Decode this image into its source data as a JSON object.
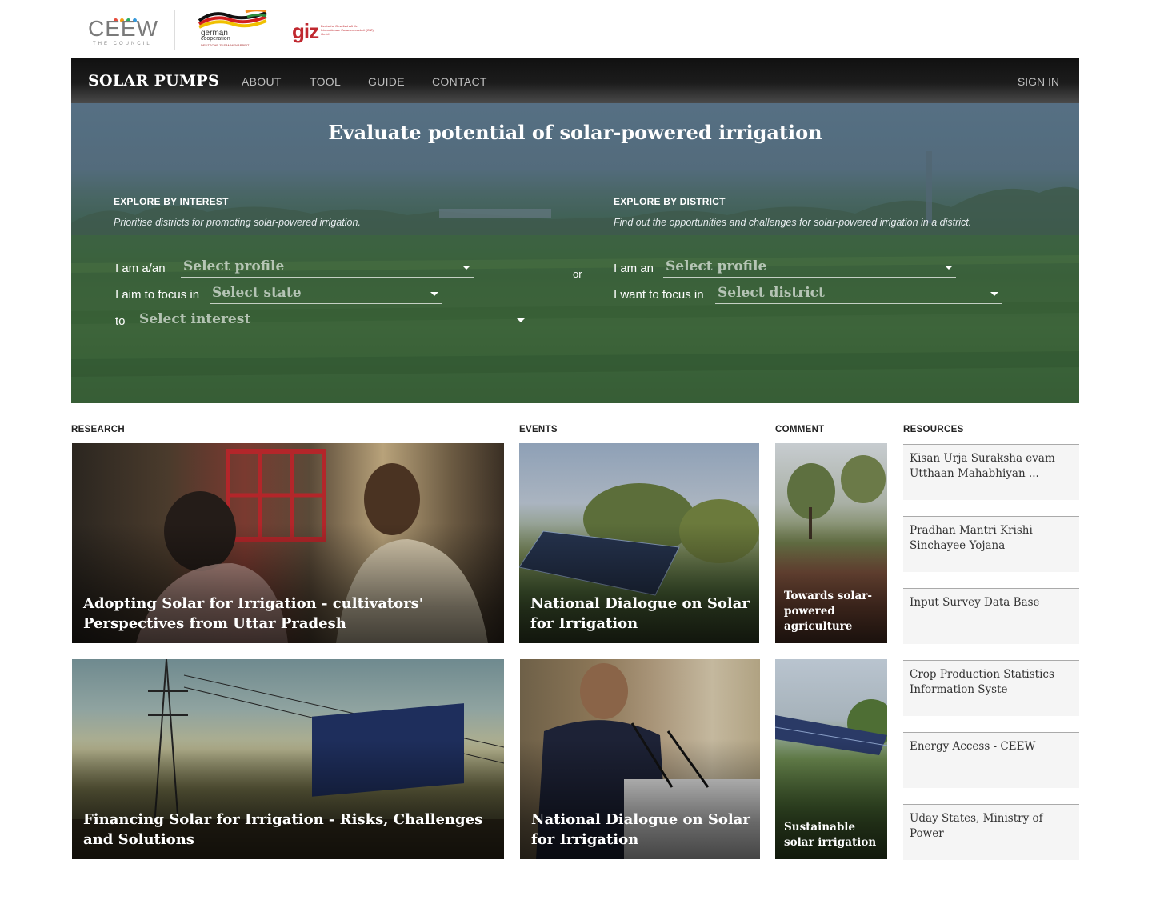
{
  "logos": {
    "ceew_word": "CEEW",
    "ceew_sub": "THE COUNCIL",
    "german_word": "german",
    "german_word2": "cooperation",
    "german_word3": "DEUTSCHE ZUSAMMENARBEIT",
    "giz_word": "giz",
    "giz_text": "Deutsche Gesellschaft für Internationale Zusammenarbeit (GIZ) GmbH",
    "ceew_dot_colors": [
      "#e74c3c",
      "#f39c12",
      "#27ae60",
      "#3498db"
    ]
  },
  "nav": {
    "brand": "SOLAR PUMPS",
    "items": [
      "ABOUT",
      "TOOL",
      "GUIDE",
      "CONTACT"
    ],
    "sign_in": "SIGN IN"
  },
  "hero": {
    "title": "Evaluate potential of solar-powered irrigation",
    "or": "or",
    "interest": {
      "label": "EXPLORE BY INTEREST",
      "desc": "Prioritise districts for promoting solar-powered irrigation.",
      "profile_label": "I am a/an",
      "profile_placeholder": "Select profile",
      "state_label": "I aim to focus in",
      "state_placeholder": "Select state",
      "interest_label": "to",
      "interest_placeholder": "Select interest"
    },
    "district": {
      "label": "EXPLORE BY DISTRICT",
      "desc": "Find out the opportunities and challenges for solar-powered irrigation in a district.",
      "profile_label": "I am an",
      "profile_placeholder": "Select profile",
      "district_label": "I want to focus in",
      "district_placeholder": "Select district"
    }
  },
  "sections": {
    "research": "RESEARCH",
    "events": "EVENTS",
    "comment": "COMMENT",
    "resources": "RESOURCES"
  },
  "research": [
    "Adopting Solar for Irrigation - cultivators' Perspectives from Uttar Pradesh",
    "Financing Solar for Irrigation - Risks, Challenges and Solutions"
  ],
  "events": [
    "National Dialogue on Solar for Irrigation",
    "National Dialogue on Solar for Irrigation"
  ],
  "comment": [
    "Towards solar-powered agriculture",
    "Sustainable solar irrigation"
  ],
  "resources": [
    "Kisan Urja Suraksha evam Utthaan Mahabhiyan ...",
    "Pradhan Mantri Krishi Sinchayee Yojana",
    "Input Survey Data Base",
    "Crop Production Statistics Information Syste",
    "Energy Access - CEEW",
    "Uday States, Ministry of Power"
  ]
}
